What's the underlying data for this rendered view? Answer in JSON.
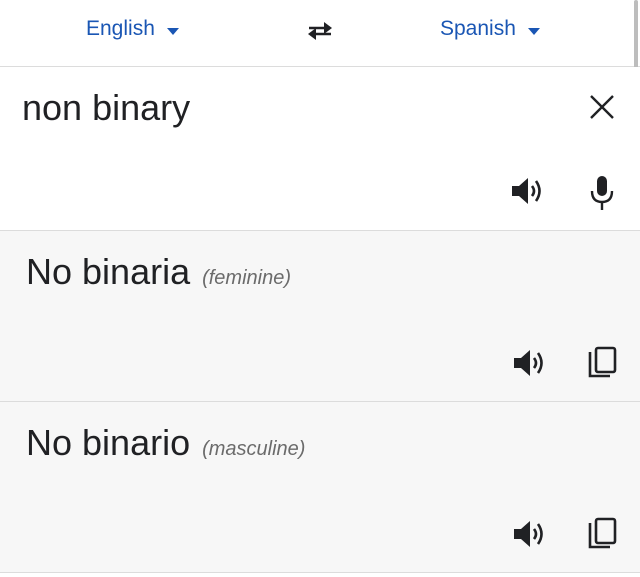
{
  "language_bar": {
    "source_language": "English",
    "target_language": "Spanish",
    "dropdown_icon": "caret-down-icon",
    "swap_icon": "swap-arrows-icon"
  },
  "input": {
    "text": "non binary",
    "clear_icon": "close-icon",
    "listen_icon": "speaker-icon",
    "voice_icon": "microphone-icon"
  },
  "results": [
    {
      "translation": "No binaria",
      "gender": "(feminine)",
      "listen_icon": "speaker-icon",
      "copy_icon": "copy-icon"
    },
    {
      "translation": "No binario",
      "gender": "(masculine)",
      "listen_icon": "speaker-icon",
      "copy_icon": "copy-icon"
    }
  ],
  "colors": {
    "accent": "#1a56b4",
    "text": "#202124",
    "secondary_text": "#6b6b6b",
    "result_background": "#f7f7f7",
    "divider": "#dcdcdc"
  }
}
